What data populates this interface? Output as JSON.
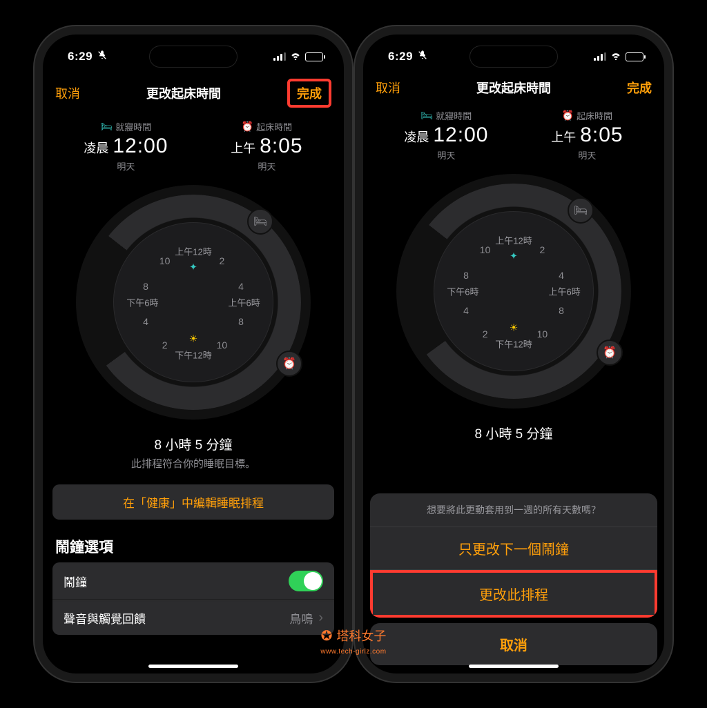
{
  "status": {
    "time": "6:29"
  },
  "nav": {
    "cancel": "取消",
    "title": "更改起床時間",
    "done": "完成"
  },
  "bedtime": {
    "label": "就寢時間",
    "prefix": "凌晨",
    "time": "12:00",
    "sub": "明天"
  },
  "wake": {
    "label": "起床時間",
    "prefix": "上午",
    "time": "8:05",
    "sub": "明天"
  },
  "dial": {
    "top": "上午12時",
    "right": "上午6時",
    "bottom": "下午12時",
    "left": "下午6時",
    "n2a": "2",
    "n4a": "4",
    "n8a": "8",
    "n10a": "10",
    "n2b": "2",
    "n4b": "4",
    "n8b": "8",
    "n10b": "10"
  },
  "duration": {
    "main": "8 小時 5 分鐘",
    "sub": "此排程符合你的睡眠目標。"
  },
  "health_button": "在「健康」中編輯睡眠排程",
  "alarm_section": {
    "header": "鬧鐘選項",
    "alarm_label": "鬧鐘",
    "sound_label": "聲音與觸覺回饋",
    "sound_value": "鳥鳴"
  },
  "sheet": {
    "title": "想要將此更動套用到一週的所有天數嗎？",
    "opt1": "只更改下一個鬧鐘",
    "opt2": "更改此排程",
    "cancel": "取消"
  },
  "watermark": {
    "text": "塔科女子",
    "sub": "www.tech-girlz.com"
  }
}
